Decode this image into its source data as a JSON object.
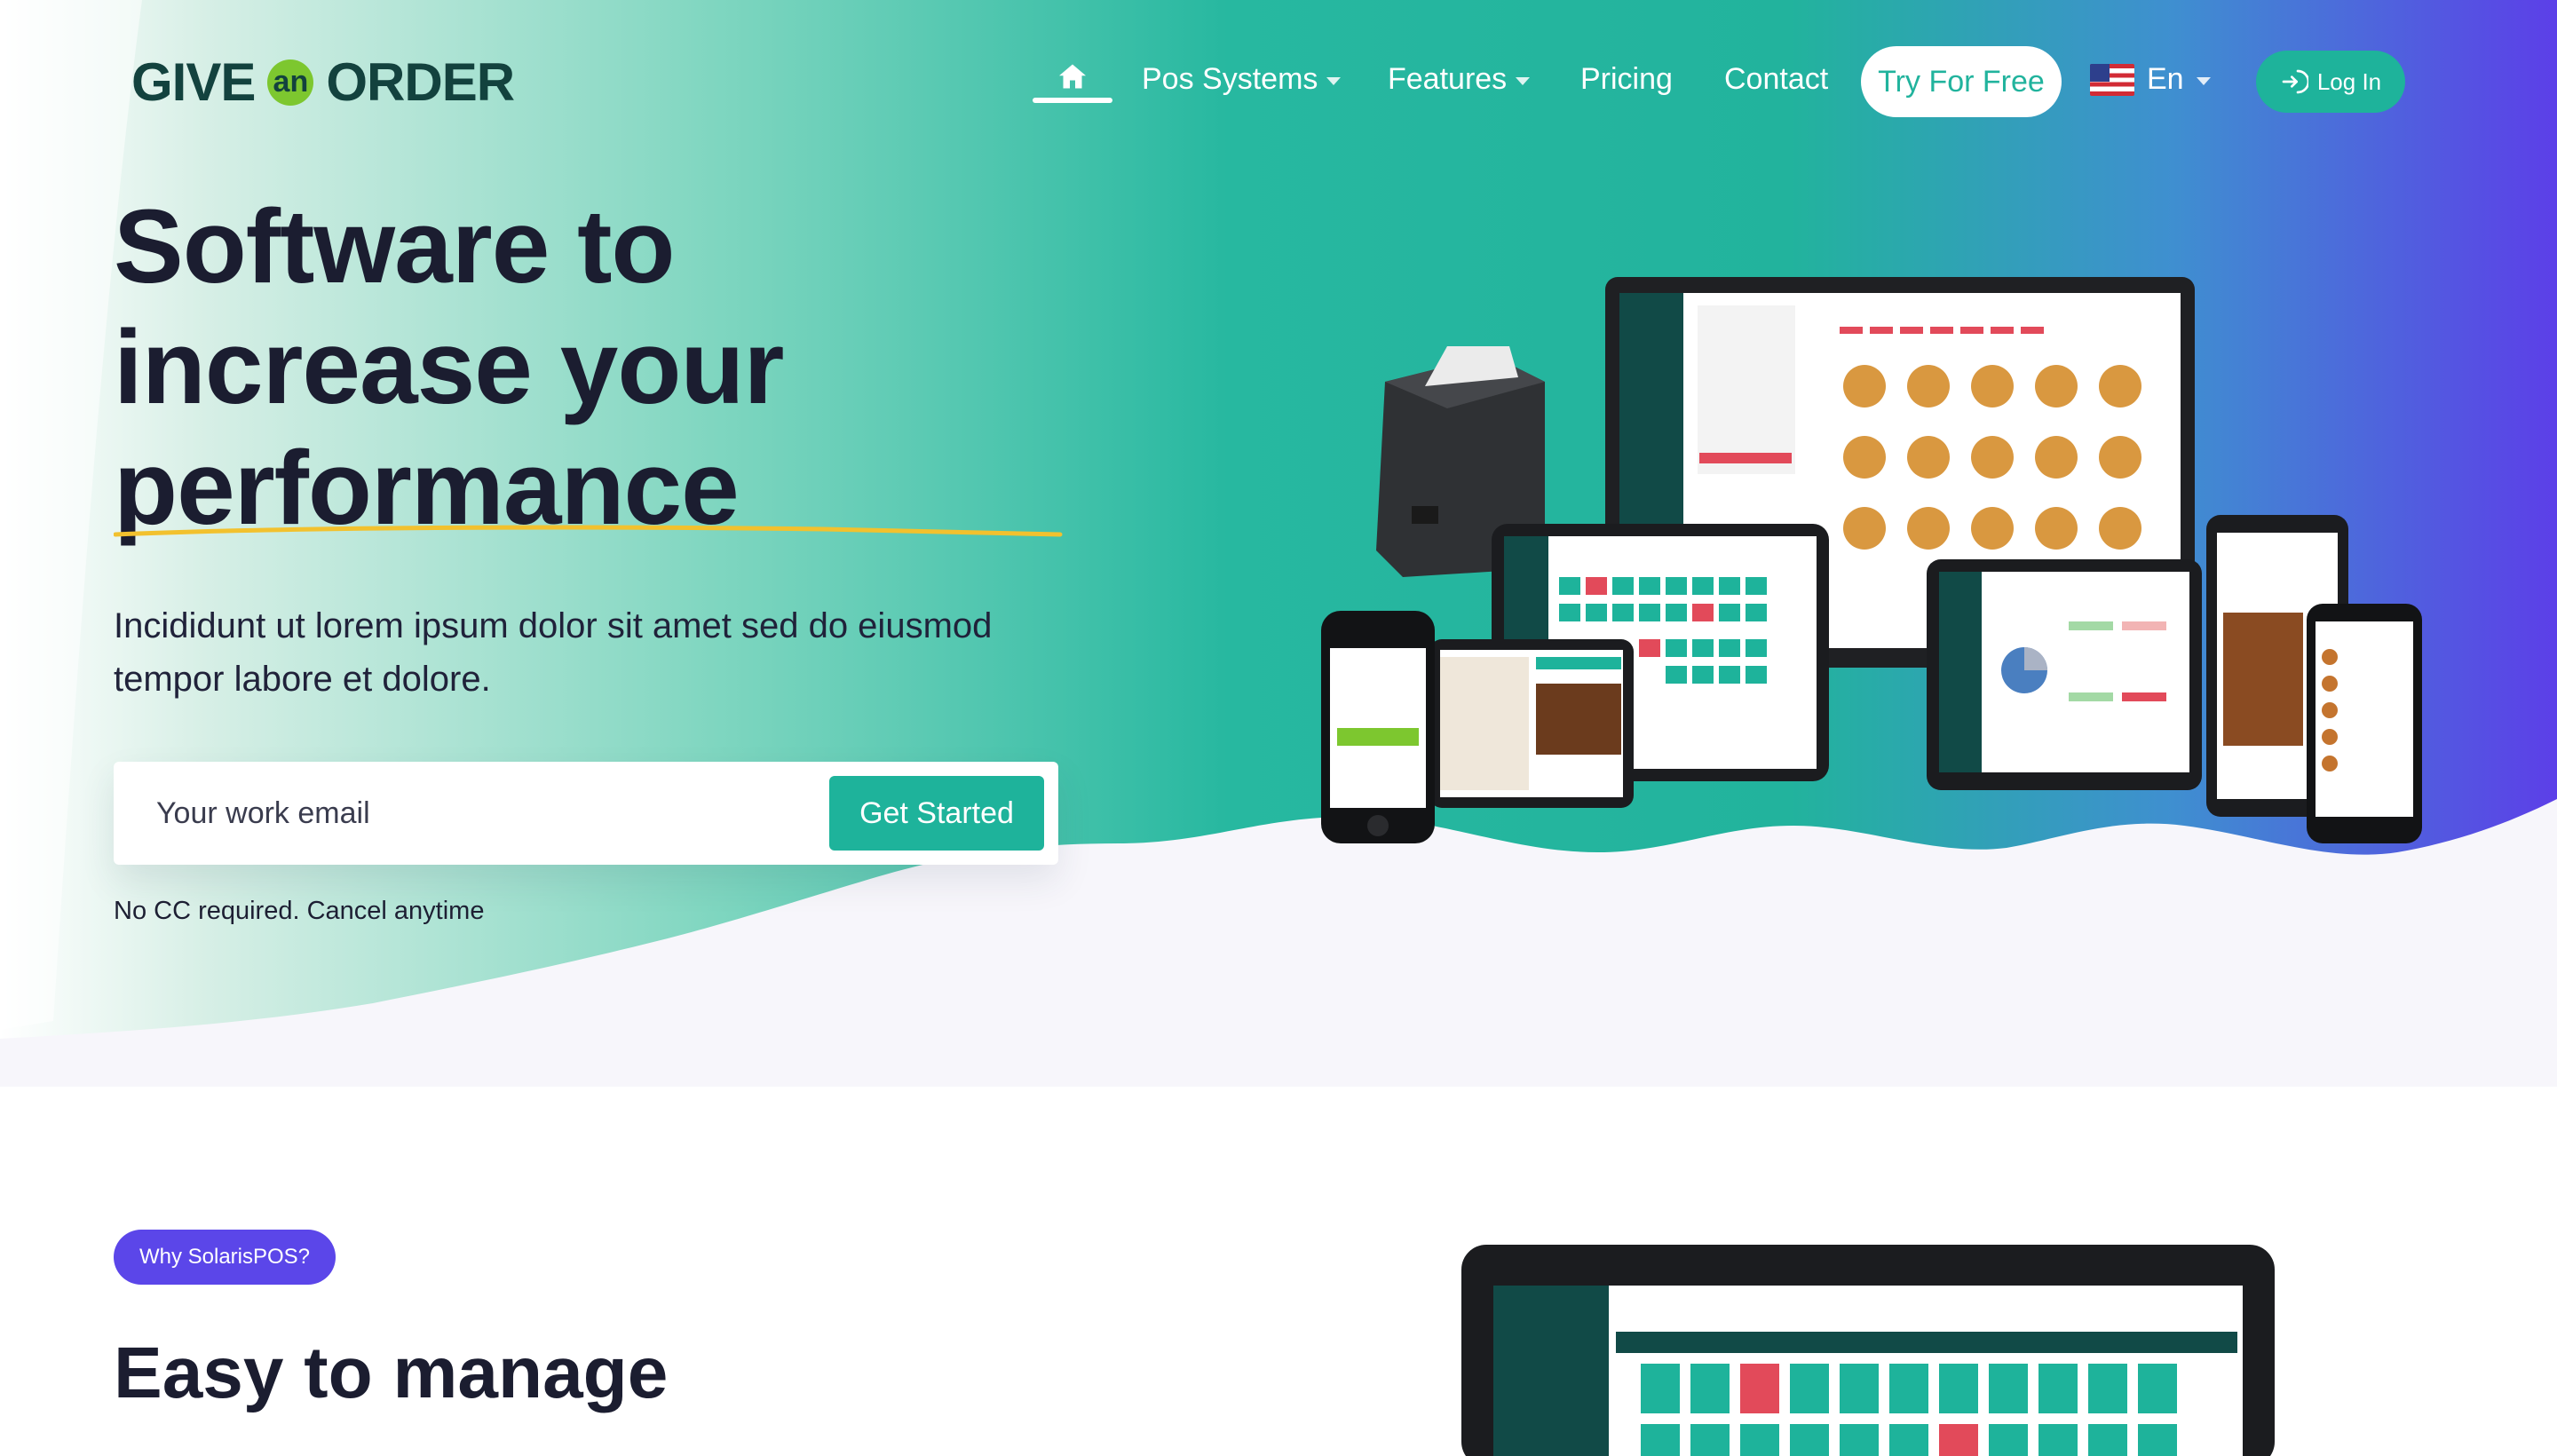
{
  "brand": {
    "word1": "GIVE",
    "connector": "an",
    "word2": "ORDER"
  },
  "nav": {
    "items": [
      {
        "label": "Pos Systems",
        "dropdown": true
      },
      {
        "label": "Features",
        "dropdown": true
      },
      {
        "label": "Pricing",
        "dropdown": false
      },
      {
        "label": "Contact",
        "dropdown": false
      }
    ],
    "try_label": "Try For Free",
    "language": "En",
    "login_label": "Log In",
    "icons": [
      "home-icon",
      "us-flag-icon",
      "login-icon",
      "chevron-down-icon"
    ]
  },
  "hero": {
    "headline": [
      "Software to",
      "increase your",
      "performance"
    ],
    "subtext": "Incididunt ut lorem ipsum dolor sit amet sed do eiusmod tempor labore et dolore.",
    "email_placeholder": "Your work email",
    "cta_label": "Get Started",
    "note": "No CC required. Cancel anytime"
  },
  "section2": {
    "badge": "Why SolarisPOS?",
    "title": "Easy to manage"
  },
  "colors": {
    "teal": "#1eb39b",
    "purple": "#5b46e9",
    "dark_text": "#1b1d30",
    "logo_dark": "#13423e",
    "logo_green": "#7dc72f",
    "underline_yellow": "#f2c12e"
  }
}
